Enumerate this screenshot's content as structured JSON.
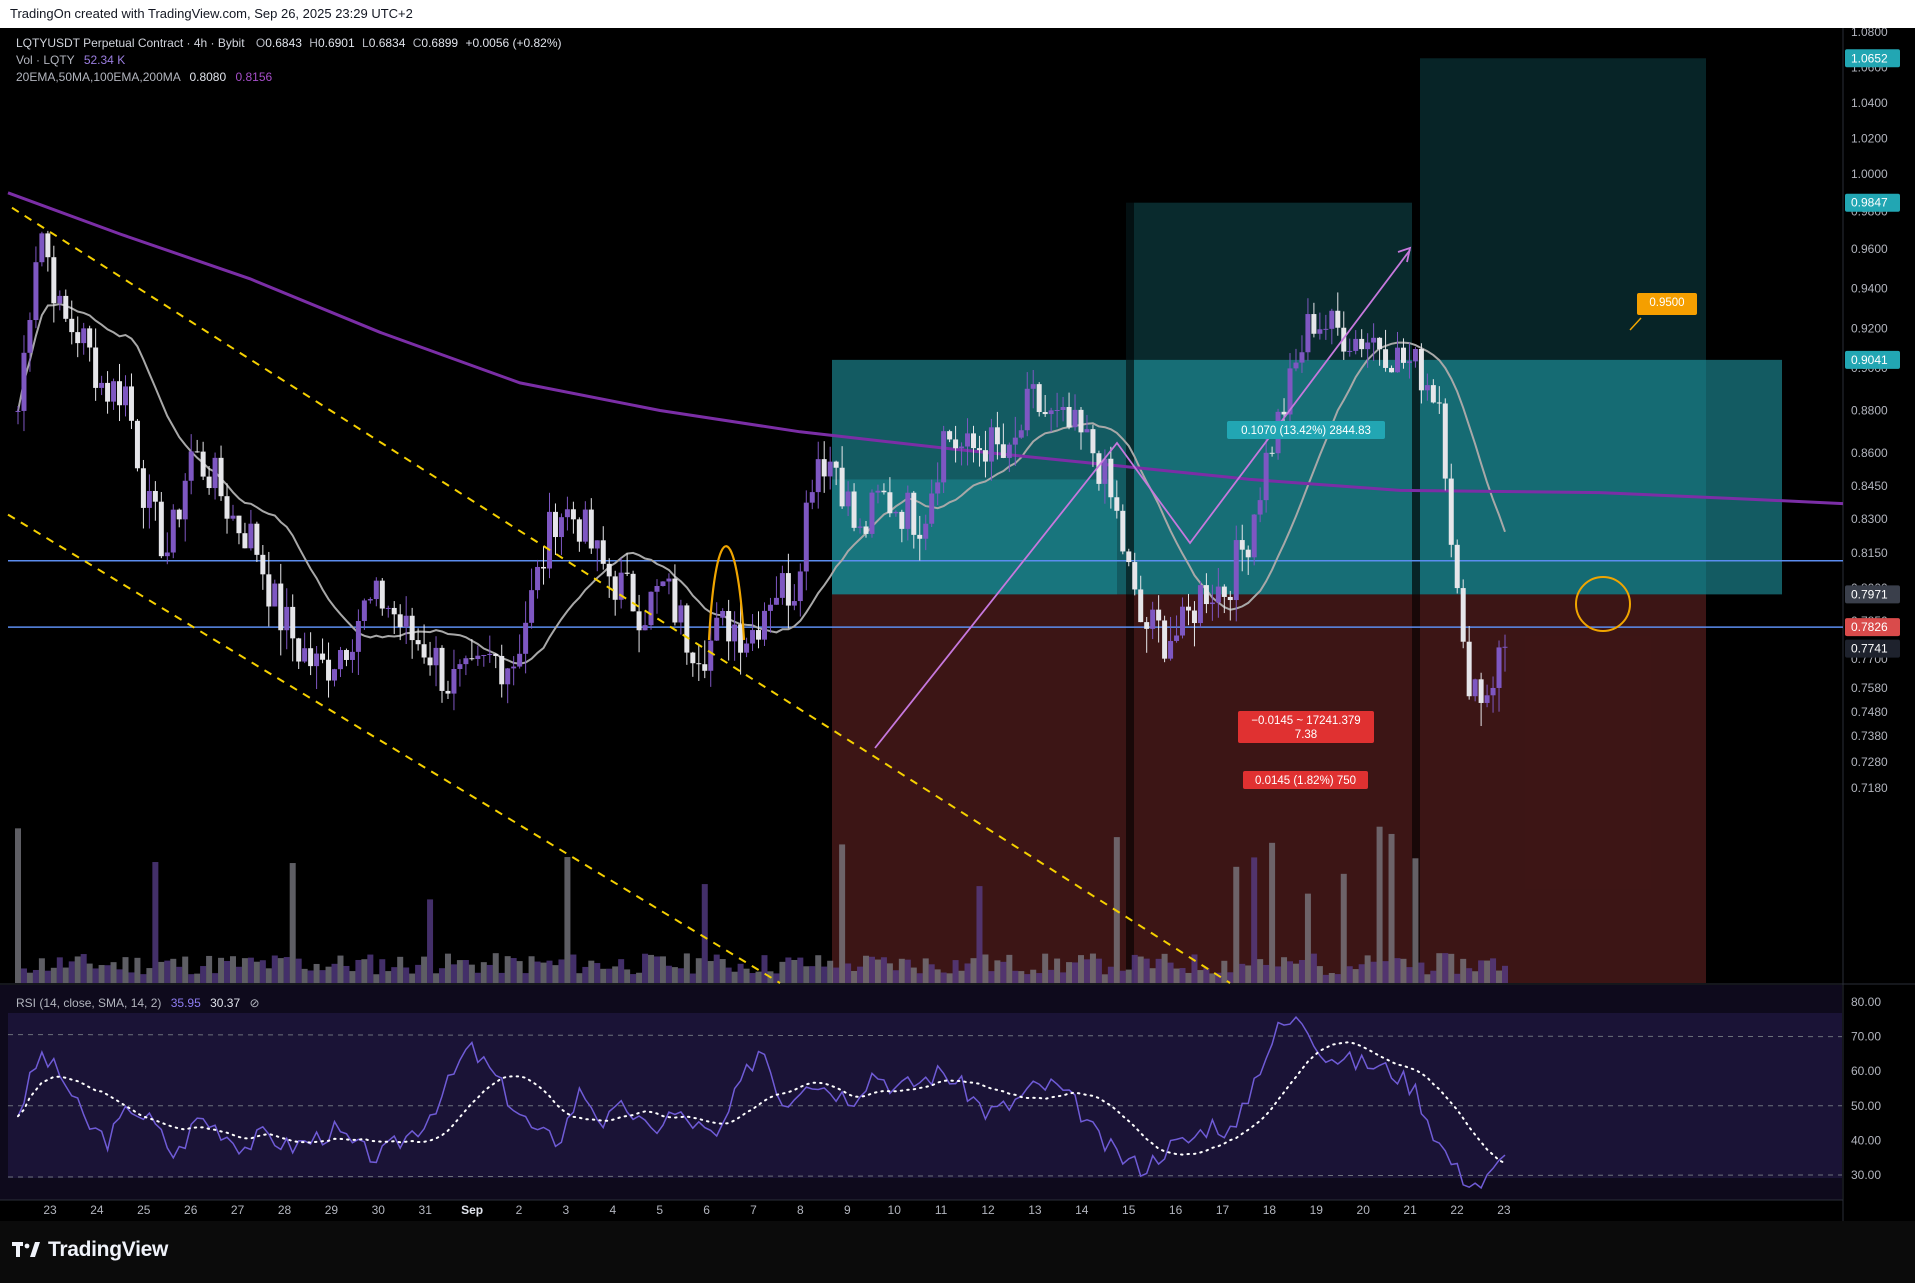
{
  "header": {
    "text": "TradingOn created with TradingView.com, Sep 26, 2025 23:29 UTC+2"
  },
  "legend": {
    "symbol": "LQTYUSDT Perpetual Contract · 4h · Bybit",
    "o_label": "O",
    "o_value": "0.6843",
    "h_label": "H",
    "h_value": "0.6901",
    "l_label": "L",
    "l_value": "0.6834",
    "c_label": "C",
    "c_value": "0.6899",
    "change": "+0.0056 (+0.82%)",
    "vol_label": "Vol · LQTY",
    "vol_value": "52.34 K",
    "ma_label": "20EMA,50MA,100EMA,200MA",
    "ma_value1": "0.8080",
    "ma_value2": "0.8156"
  },
  "rsi_legend": {
    "label": "RSI (14, close, SMA, 14, 2)",
    "value1": "35.95",
    "value2": "30.37",
    "icon": "eye-off-icon"
  },
  "colors": {
    "bull": "#7e57c2",
    "bear": "#e6e6ea",
    "ema": "#a8a8a8",
    "ma200": "#7b2ea6",
    "trend": "#f5d000",
    "hline": "#5b8def",
    "target": "#22a6b3",
    "stop": "#d94b4b",
    "rsi": "#6f5bd6",
    "rsi_sma": "#ffffff",
    "circle": "#f0a500",
    "path": "#c678dd"
  },
  "footer": {
    "brand": "TradingView",
    "icon": "tradingview-logo-icon"
  },
  "chart_data": {
    "type": "candlestick",
    "title": "LQTYUSDT Perpetual Contract · 4h · Bybit",
    "x_tick_labels": [
      "23",
      "24",
      "25",
      "26",
      "27",
      "28",
      "29",
      "30",
      "31",
      "Sep",
      "2",
      "3",
      "4",
      "5",
      "6",
      "7",
      "8",
      "9",
      "10",
      "11",
      "12",
      "13",
      "14",
      "15",
      "16",
      "17",
      "18",
      "19",
      "20",
      "21",
      "22",
      "23"
    ],
    "y_ticks": [
      "1.0800",
      "1.0600",
      "1.0400",
      "1.0200",
      "1.0000",
      "0.9800",
      "0.9600",
      "0.9400",
      "0.9200",
      "0.9000",
      "0.8800",
      "0.8600",
      "0.8450",
      "0.8300",
      "0.8150",
      "0.8000",
      "0.7850",
      "0.7700",
      "0.7580",
      "0.7480",
      "0.7380",
      "0.7280",
      "0.7180"
    ],
    "price_tags": [
      {
        "text": "1.0652",
        "value": 1.0652,
        "color": "#22a6b3"
      },
      {
        "text": "0.9847",
        "value": 0.9847,
        "color": "#22a6b3"
      },
      {
        "text": "0.9041",
        "value": 0.9041,
        "color": "#22a6b3"
      },
      {
        "text": "0.7971",
        "value": 0.7971,
        "color": "#3a3f4b"
      },
      {
        "text": "0.7826",
        "value": 0.7826,
        "color": "#d94b4b"
      },
      {
        "text": "0.7741",
        "value": 0.7741,
        "color": "#1e222d"
      }
    ],
    "annotations": [
      {
        "text": "0.1070 (13.42%) 2844.83",
        "color": "#22a6b3"
      },
      {
        "text": "−0.0145 ~ 17241.379",
        "text2": "7.38",
        "color": "#e03131"
      },
      {
        "text": "0.0145 (1.82%) 750",
        "color": "#e03131"
      },
      {
        "text": "0.9500",
        "color": "#f59f00"
      }
    ],
    "horizontal_levels": [
      0.8117,
      0.7826
    ],
    "ohlc_anchor_closes": [
      0.88,
      0.975,
      0.925,
      0.915,
      0.89,
      0.89,
      0.835,
      0.815,
      0.86,
      0.85,
      0.83,
      0.82,
      0.79,
      0.775,
      0.765,
      0.775,
      0.79,
      0.795,
      0.78,
      0.775,
      0.76,
      0.76,
      0.77,
      0.77,
      0.8,
      0.835,
      0.83,
      0.81,
      0.8,
      0.79,
      0.8,
      0.78,
      0.775,
      0.785,
      0.78,
      0.8,
      0.8,
      0.86,
      0.855,
      0.82,
      0.84,
      0.835,
      0.83,
      0.87,
      0.86,
      0.865,
      0.855,
      0.885,
      0.875,
      0.87,
      0.86,
      0.83,
      0.785,
      0.78,
      0.78,
      0.8,
      0.8,
      0.82,
      0.86,
      0.89,
      0.925,
      0.92,
      0.915,
      0.915,
      0.905,
      0.9,
      0.885,
      0.77,
      0.755,
      0.775
    ],
    "rsi_y_ticks": [
      "80.00",
      "70.00",
      "60.00",
      "50.00",
      "40.00",
      "30.00"
    ],
    "rsi_anchor_values": [
      48,
      65,
      58,
      45,
      40,
      50,
      45,
      35,
      47,
      43,
      38,
      42,
      38,
      40,
      43,
      38,
      35,
      40,
      45,
      55,
      67,
      60,
      50,
      42,
      40,
      55,
      45,
      50,
      42,
      48,
      45,
      40,
      55,
      68,
      50,
      58,
      55,
      52,
      60,
      55,
      57,
      60,
      55,
      48,
      50,
      55,
      56,
      50,
      40,
      35,
      32,
      38,
      40,
      45,
      42,
      60,
      73,
      75,
      65,
      63,
      62,
      60,
      55,
      40,
      30,
      27,
      35
    ]
  }
}
